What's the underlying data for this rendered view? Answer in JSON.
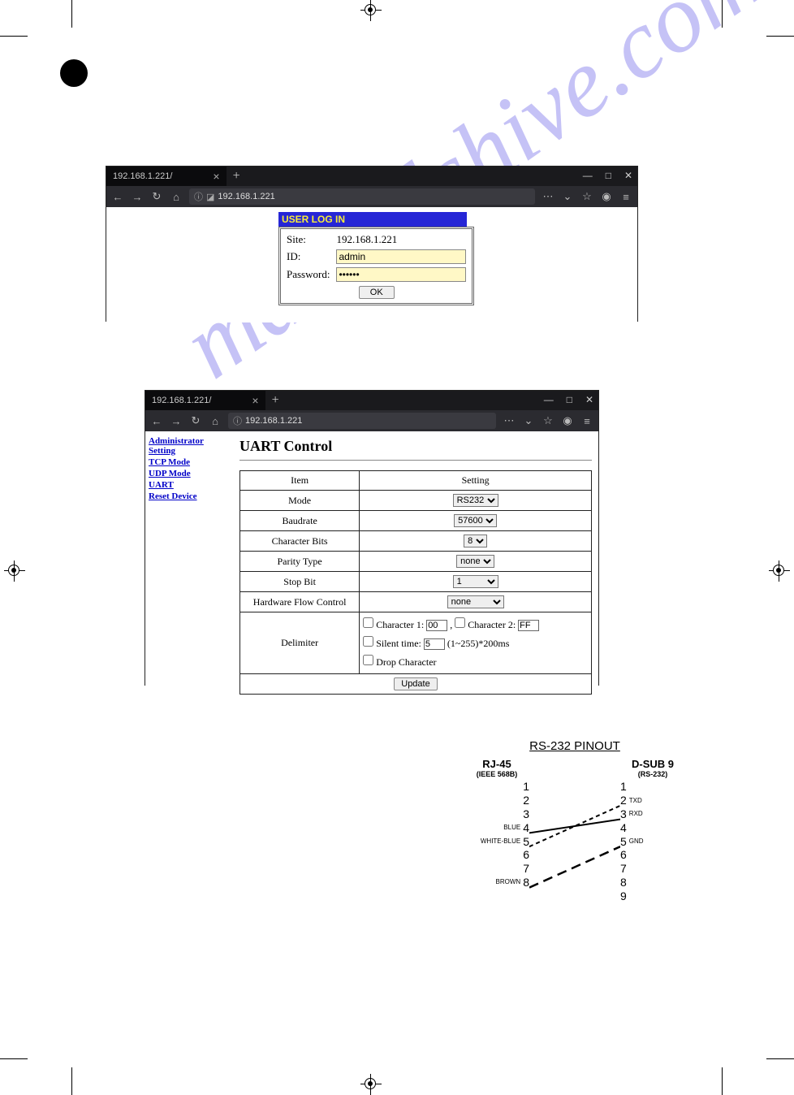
{
  "browser": {
    "tab_title": "192.168.1.221/",
    "url": "192.168.1.221",
    "url_scheme_icon": "ⓘ",
    "minimize": "—",
    "maximize": "□",
    "close": "✕"
  },
  "login": {
    "header": "USER LOG IN",
    "site_label": "Site:",
    "site_value": "192.168.1.221",
    "id_label": "ID:",
    "id_value": "admin",
    "pw_label": "Password:",
    "pw_value": "••••••",
    "ok": "OK"
  },
  "sidebar": {
    "items": [
      "Administrator Setting",
      "TCP Mode",
      "UDP Mode",
      "UART",
      "Reset Device"
    ]
  },
  "uart": {
    "heading": "UART Control",
    "col_item": "Item",
    "col_setting": "Setting",
    "rows": {
      "mode": {
        "label": "Mode",
        "value": "RS232"
      },
      "baud": {
        "label": "Baudrate",
        "value": "57600"
      },
      "bits": {
        "label": "Character Bits",
        "value": "8"
      },
      "parity": {
        "label": "Parity Type",
        "value": "none"
      },
      "stop": {
        "label": "Stop Bit",
        "value": "1"
      },
      "flow": {
        "label": "Hardware Flow Control",
        "value": "none"
      },
      "delim": {
        "label": "Delimiter",
        "char1_label": "Character 1:",
        "char1_value": "00",
        "char2_label": "Character 2:",
        "char2_value": "FF",
        "silent_label": "Silent time:",
        "silent_value": "5",
        "silent_suffix": "(1~255)*200ms",
        "drop_label": "Drop Character"
      }
    },
    "update": "Update"
  },
  "pinout": {
    "title": "RS-232 PINOUT",
    "left_heading": "RJ-45",
    "left_sub": "(IEEE 568B)",
    "right_heading": "D-SUB 9",
    "right_sub": "(RS-232)",
    "left_pins": [
      {
        "n": "1",
        "lbl": ""
      },
      {
        "n": "2",
        "lbl": ""
      },
      {
        "n": "3",
        "lbl": ""
      },
      {
        "n": "4",
        "lbl": "BLUE"
      },
      {
        "n": "5",
        "lbl": "WHITE-BLUE"
      },
      {
        "n": "6",
        "lbl": ""
      },
      {
        "n": "7",
        "lbl": ""
      },
      {
        "n": "8",
        "lbl": "BROWN"
      }
    ],
    "right_pins": [
      {
        "n": "1",
        "lbl": ""
      },
      {
        "n": "2",
        "lbl": "TXD"
      },
      {
        "n": "3",
        "lbl": "RXD"
      },
      {
        "n": "4",
        "lbl": ""
      },
      {
        "n": "5",
        "lbl": "GND"
      },
      {
        "n": "6",
        "lbl": ""
      },
      {
        "n": "7",
        "lbl": ""
      },
      {
        "n": "8",
        "lbl": ""
      },
      {
        "n": "9",
        "lbl": ""
      }
    ]
  },
  "watermark": "manualshive.com"
}
